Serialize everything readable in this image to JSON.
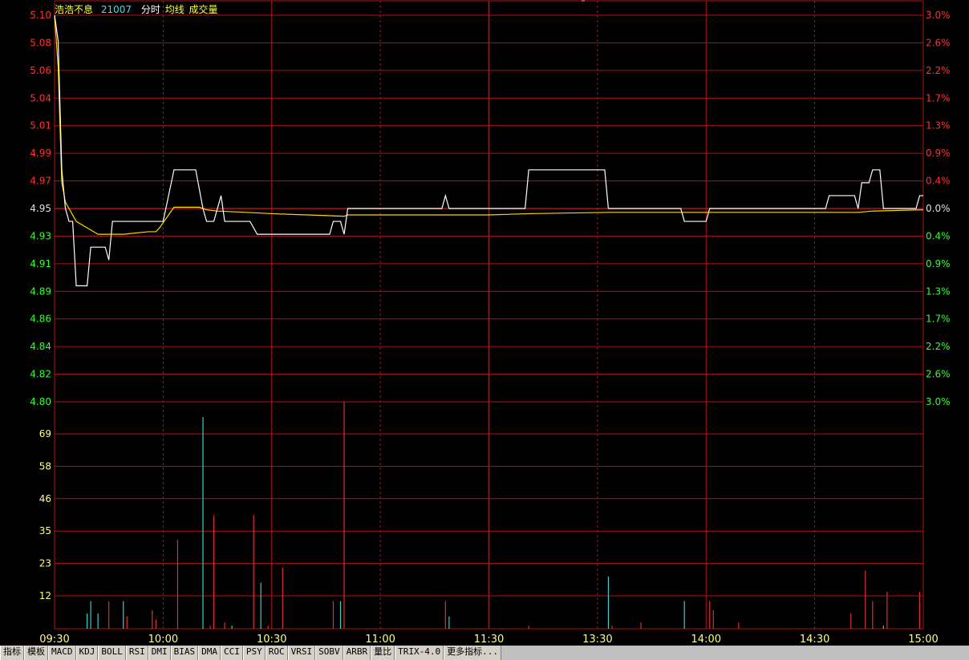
{
  "header": {
    "stock_name": "浩浩不息",
    "code": "21007",
    "labels": [
      "分时",
      "均线",
      "成交量"
    ]
  },
  "tabs": [
    "指标",
    "模板",
    "MACD",
    "KDJ",
    "BOLL",
    "RSI",
    "DMI",
    "BIAS",
    "DMA",
    "CCI",
    "PSY",
    "ROC",
    "VRSI",
    "SOBV",
    "ARBR",
    "量比",
    "TRIX-4.0",
    "更多指标..."
  ],
  "colors": {
    "grid": "#b4101a",
    "up": "#ff3030",
    "down": "#30ff30",
    "price_line": "#ffffff",
    "avg_line": "#ffd700",
    "vol_up": "#e03030",
    "vol_down": "#30d0d0",
    "axis_text": "#e0e0e0",
    "vol_axis_text": "#ffff80"
  },
  "chart_data": {
    "type": "line",
    "prev_close": 4.95,
    "price_axis": {
      "ticks": [
        "5.10",
        "5.08",
        "5.06",
        "5.04",
        "5.01",
        "4.99",
        "4.97",
        "4.95",
        "4.93",
        "4.91",
        "4.89",
        "4.86",
        "4.84",
        "4.82",
        "4.80"
      ],
      "pct_ticks": [
        "3.0%",
        "2.6%",
        "2.2%",
        "1.7%",
        "1.3%",
        "0.9%",
        "0.4%",
        "0.0%",
        "0.4%",
        "0.9%",
        "1.3%",
        "1.7%",
        "2.2%",
        "2.6%",
        "3.0%"
      ],
      "ylim": [
        4.8,
        5.1
      ]
    },
    "volume_axis": {
      "ticks": [
        "69",
        "58",
        "46",
        "35",
        "23",
        "12"
      ],
      "ylim": [
        0,
        74
      ]
    },
    "time_labels": [
      "09:30",
      "10:00",
      "10:30",
      "11:00",
      "11:30",
      "13:30",
      "14:00",
      "14:30",
      "15:00"
    ],
    "session_minutes": 240,
    "price": [
      [
        0,
        5.1
      ],
      [
        1,
        5.08
      ],
      [
        2,
        4.98
      ],
      [
        3,
        4.95
      ],
      [
        4,
        4.94
      ],
      [
        5,
        4.94
      ],
      [
        6,
        4.89
      ],
      [
        8,
        4.89
      ],
      [
        9,
        4.89
      ],
      [
        10,
        4.92
      ],
      [
        14,
        4.92
      ],
      [
        15,
        4.91
      ],
      [
        16,
        4.94
      ],
      [
        27,
        4.94
      ],
      [
        28,
        4.94
      ],
      [
        30,
        4.94
      ],
      [
        33,
        4.98
      ],
      [
        39,
        4.98
      ],
      [
        41,
        4.95
      ],
      [
        42,
        4.94
      ],
      [
        44,
        4.94
      ],
      [
        46,
        4.96
      ],
      [
        47,
        4.94
      ],
      [
        54,
        4.94
      ],
      [
        56,
        4.93
      ],
      [
        76,
        4.93
      ],
      [
        77,
        4.94
      ],
      [
        79,
        4.94
      ],
      [
        80,
        4.93
      ],
      [
        81,
        4.95
      ],
      [
        107,
        4.95
      ],
      [
        108,
        4.96
      ],
      [
        109,
        4.95
      ],
      [
        130,
        4.95
      ],
      [
        131,
        4.98
      ],
      [
        152,
        4.98
      ],
      [
        153,
        4.95
      ],
      [
        173,
        4.95
      ],
      [
        174,
        4.94
      ],
      [
        180,
        4.94
      ],
      [
        181,
        4.95
      ],
      [
        213,
        4.95
      ],
      [
        214,
        4.96
      ],
      [
        221,
        4.96
      ],
      [
        222,
        4.95
      ],
      [
        223,
        4.97
      ],
      [
        225,
        4.97
      ],
      [
        226,
        4.98
      ],
      [
        228,
        4.98
      ],
      [
        229,
        4.95
      ],
      [
        238,
        4.95
      ],
      [
        239,
        4.96
      ],
      [
        240,
        4.96
      ]
    ],
    "avg": [
      [
        0,
        5.1
      ],
      [
        1,
        5.06
      ],
      [
        2,
        4.97
      ],
      [
        3,
        4.955
      ],
      [
        4,
        4.95
      ],
      [
        5,
        4.945
      ],
      [
        6,
        4.94
      ],
      [
        9,
        4.935
      ],
      [
        12,
        4.93
      ],
      [
        15,
        4.93
      ],
      [
        19,
        4.93
      ],
      [
        26,
        4.932
      ],
      [
        28,
        4.932
      ],
      [
        29,
        4.935
      ],
      [
        33,
        4.951
      ],
      [
        40,
        4.951
      ],
      [
        42,
        4.949
      ],
      [
        45,
        4.948
      ],
      [
        53,
        4.947
      ],
      [
        60,
        4.946
      ],
      [
        70,
        4.945
      ],
      [
        80,
        4.944
      ],
      [
        81,
        4.945
      ],
      [
        100,
        4.945
      ],
      [
        120,
        4.945
      ],
      [
        131,
        4.946
      ],
      [
        153,
        4.947
      ],
      [
        175,
        4.947
      ],
      [
        200,
        4.947
      ],
      [
        222,
        4.947
      ],
      [
        226,
        4.948
      ],
      [
        240,
        4.949
      ]
    ],
    "volume": [
      {
        "t": 9,
        "v": 5,
        "dir": "down"
      },
      {
        "t": 10,
        "v": 9,
        "dir": "down"
      },
      {
        "t": 12,
        "v": 5,
        "dir": "down"
      },
      {
        "t": 15,
        "v": 9,
        "dir": "up"
      },
      {
        "t": 19,
        "v": 9,
        "dir": "down"
      },
      {
        "t": 20,
        "v": 4,
        "dir": "up"
      },
      {
        "t": 27,
        "v": 6,
        "dir": "up"
      },
      {
        "t": 28,
        "v": 3,
        "dir": "up"
      },
      {
        "t": 34,
        "v": 29,
        "dir": "up"
      },
      {
        "t": 41,
        "v": 69,
        "dir": "down"
      },
      {
        "t": 43,
        "v": 1,
        "dir": "up"
      },
      {
        "t": 44,
        "v": 37,
        "dir": "up"
      },
      {
        "t": 47,
        "v": 2,
        "dir": "up"
      },
      {
        "t": 49,
        "v": 1,
        "dir": "down"
      },
      {
        "t": 55,
        "v": 37,
        "dir": "up"
      },
      {
        "t": 57,
        "v": 15,
        "dir": "down"
      },
      {
        "t": 59,
        "v": 1,
        "dir": "up"
      },
      {
        "t": 63,
        "v": 20,
        "dir": "up"
      },
      {
        "t": 77,
        "v": 9,
        "dir": "up"
      },
      {
        "t": 79,
        "v": 9,
        "dir": "down"
      },
      {
        "t": 80,
        "v": 80,
        "dir": "up"
      },
      {
        "t": 108,
        "v": 9,
        "dir": "up"
      },
      {
        "t": 109,
        "v": 4,
        "dir": "down"
      },
      {
        "t": 131,
        "v": 1,
        "dir": "up"
      },
      {
        "t": 153,
        "v": 17,
        "dir": "down"
      },
      {
        "t": 154,
        "v": 1,
        "dir": "up"
      },
      {
        "t": 162,
        "v": 2,
        "dir": "up"
      },
      {
        "t": 174,
        "v": 9,
        "dir": "down"
      },
      {
        "t": 181,
        "v": 9,
        "dir": "up"
      },
      {
        "t": 182,
        "v": 6,
        "dir": "up"
      },
      {
        "t": 189,
        "v": 2,
        "dir": "up"
      },
      {
        "t": 220,
        "v": 5,
        "dir": "up"
      },
      {
        "t": 224,
        "v": 19,
        "dir": "up"
      },
      {
        "t": 226,
        "v": 9,
        "dir": "up"
      },
      {
        "t": 229,
        "v": 1,
        "dir": "down"
      },
      {
        "t": 230,
        "v": 12,
        "dir": "up"
      },
      {
        "t": 239,
        "v": 12,
        "dir": "up"
      }
    ]
  }
}
